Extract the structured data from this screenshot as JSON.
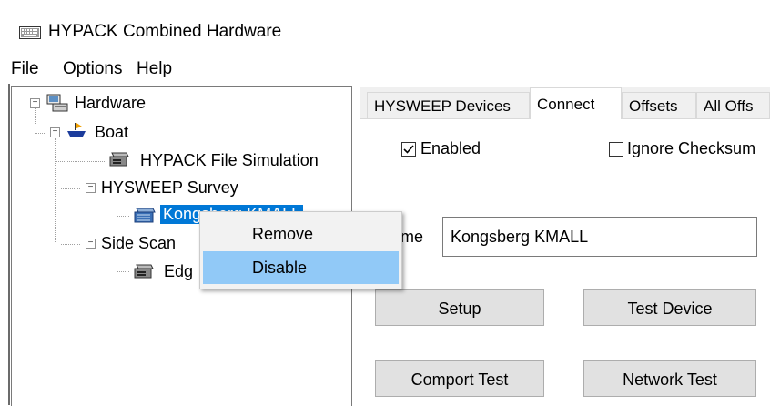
{
  "window": {
    "title": "HYPACK Combined Hardware"
  },
  "menu": {
    "items": [
      "File",
      "Options",
      "Help"
    ]
  },
  "tree": {
    "hardware": "Hardware",
    "boat": "Boat",
    "file_sim": "HYPACK File Simulation",
    "hysweep_survey": "HYSWEEP Survey",
    "kongsberg": "Kongsberg KMALL",
    "side_scan": "Side Scan",
    "edge": "Edg"
  },
  "tabs": {
    "items": [
      "HYSWEEP Devices",
      "Connect",
      "Offsets",
      "All Offs"
    ],
    "active": "Connect"
  },
  "connect": {
    "enabled_label": "Enabled",
    "enabled_checked": true,
    "ignore_checksum_label": "Ignore Checksum",
    "ignore_checksum_checked": false,
    "name_label": "Name",
    "name_value": "Kongsberg KMALL",
    "setup_label": "Setup",
    "test_device_label": "Test Device",
    "comport_test_label": "Comport Test",
    "network_test_label": "Network Test"
  },
  "context_menu": {
    "items": [
      "Remove",
      "Disable"
    ],
    "highlighted": "Disable"
  },
  "colors": {
    "selection": "#0078d7",
    "menu_hover": "#91c9f7",
    "button_face": "#e1e1e1"
  }
}
